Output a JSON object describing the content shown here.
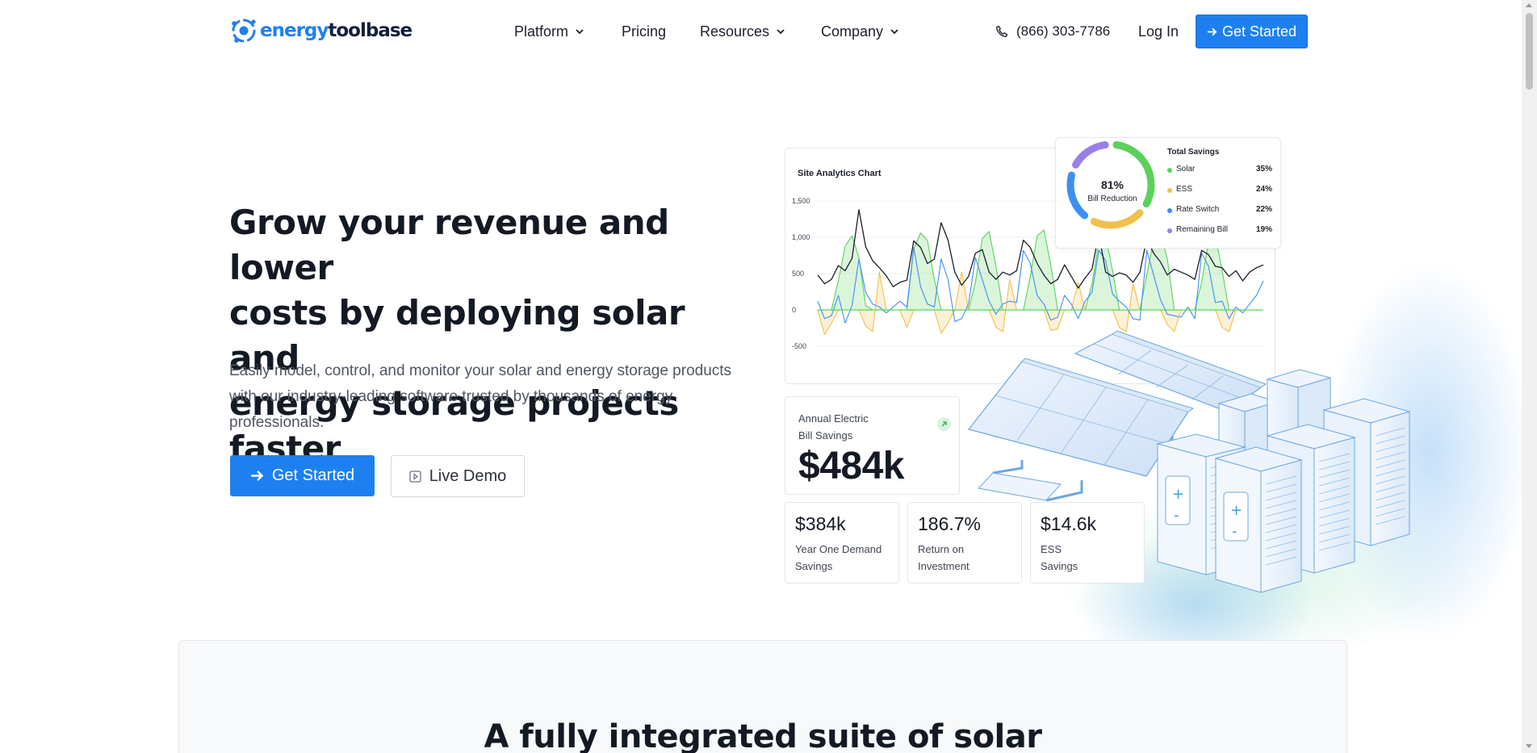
{
  "header": {
    "logo": {
      "part1": "energy",
      "part2": "toolbase"
    },
    "nav": [
      {
        "label": "Platform",
        "has_dropdown": true
      },
      {
        "label": "Pricing",
        "has_dropdown": false
      },
      {
        "label": "Resources",
        "has_dropdown": true
      },
      {
        "label": "Company",
        "has_dropdown": true
      }
    ],
    "phone": "(866) 303-7786",
    "login": "Log In",
    "cta": "Get Started"
  },
  "hero": {
    "title_lines": [
      "Grow your revenue and lower",
      "costs by deploying solar and",
      "energy storage projects faster"
    ],
    "subtitle_lines": [
      "Easily model, control, and monitor your solar and energy storage products",
      "with our industry-leading software trusted by thousands of energy",
      "professionals."
    ],
    "primary_button": "Get Started",
    "secondary_button": "Live Demo"
  },
  "colors": {
    "accent": "#1e80f0",
    "solar": "#5ad25a",
    "ess": "#f0c04a",
    "rate_switch": "#3c8ff0",
    "remaining_bill": "#9a7ee8",
    "load_line": "#1b1f2a"
  },
  "chart_data": {
    "type": "line",
    "title": "Site Analytics Chart",
    "ylim": [
      -500,
      1500
    ],
    "yticks": [
      "1,500",
      "1,000",
      "500",
      "0",
      "-500"
    ],
    "ytick_values": [
      1500,
      1000,
      500,
      0,
      -500
    ],
    "series": [
      {
        "color_key": "load_line",
        "values": [
          480,
          360,
          420,
          610,
          540,
          710,
          1380,
          870,
          680,
          580,
          470,
          320,
          380,
          410,
          950,
          860,
          640,
          700,
          1200,
          960,
          520,
          340,
          460,
          780,
          830,
          520,
          420,
          520,
          480,
          540,
          960,
          860,
          640,
          480,
          360,
          420,
          620,
          460,
          300,
          440,
          560,
          1050,
          520,
          460,
          510,
          480,
          380,
          520,
          980,
          780,
          660,
          480,
          560,
          520,
          480,
          420,
          820,
          760,
          600,
          580,
          460,
          540,
          400,
          520,
          580,
          620
        ]
      },
      {
        "color_key": "rate_switch",
        "values": [
          120,
          -120,
          -80,
          200,
          -180,
          60,
          700,
          240,
          80,
          40,
          -40,
          40,
          120,
          40,
          860,
          320,
          80,
          40,
          700,
          420,
          -160,
          -120,
          80,
          720,
          420,
          120,
          -60,
          80,
          120,
          100,
          820,
          640,
          200,
          80,
          -140,
          -100,
          200,
          80,
          -120,
          120,
          240,
          820,
          680,
          220,
          120,
          40,
          -120,
          -140,
          820,
          480,
          140,
          -60,
          -80,
          -100,
          40,
          -120,
          780,
          600,
          100,
          120,
          -120,
          40,
          -40,
          80,
          200,
          400
        ]
      },
      {
        "color_key": "solar",
        "values": [
          0,
          0,
          0,
          400,
          880,
          1020,
          720,
          60,
          0,
          0,
          0,
          0,
          0,
          0,
          840,
          1060,
          960,
          420,
          0,
          0,
          0,
          0,
          0,
          380,
          980,
          1080,
          600,
          0,
          0,
          0,
          0,
          460,
          1020,
          1100,
          620,
          0,
          0,
          0,
          0,
          0,
          360,
          940,
          1020,
          540,
          0,
          0,
          0,
          0,
          480,
          960,
          1060,
          700,
          0,
          0,
          0,
          0,
          380,
          940,
          1020,
          540,
          0,
          0,
          0,
          0,
          0,
          0
        ]
      },
      {
        "color_key": "ess",
        "values": [
          0,
          -340,
          -180,
          0,
          0,
          0,
          0,
          -220,
          -300,
          520,
          0,
          0,
          0,
          -240,
          0,
          0,
          0,
          0,
          -320,
          -180,
          0,
          520,
          0,
          0,
          0,
          0,
          -240,
          -300,
          420,
          0,
          0,
          0,
          0,
          0,
          -280,
          -260,
          0,
          0,
          380,
          0,
          0,
          0,
          0,
          0,
          -240,
          -300,
          360,
          0,
          0,
          0,
          0,
          -200,
          -300,
          0,
          0,
          0,
          0,
          0,
          0,
          -240,
          -300,
          0,
          0,
          0,
          0,
          0
        ]
      }
    ]
  },
  "donut": {
    "center_value": "81%",
    "center_label": "Bill Reduction",
    "legend_title": "Total Savings",
    "items": [
      {
        "name": "Solar",
        "pct": "35%",
        "value": 35,
        "color_key": "solar"
      },
      {
        "name": "ESS",
        "pct": "24%",
        "value": 24,
        "color_key": "ess"
      },
      {
        "name": "Rate Switch",
        "pct": "22%",
        "value": 22,
        "color_key": "rate_switch"
      },
      {
        "name": "Remaining Bill",
        "pct": "19%",
        "value": 19,
        "color_key": "remaining_bill"
      }
    ]
  },
  "stats": {
    "big": {
      "label_lines": [
        "Annual Electric",
        "Bill Savings"
      ],
      "value": "$484k"
    },
    "small": [
      {
        "value": "$384k",
        "label_lines": [
          "Year One Demand",
          "Savings"
        ]
      },
      {
        "value": "186.7%",
        "label_lines": [
          "Return on",
          "Investment"
        ]
      },
      {
        "value": "$14.6k",
        "label_lines": [
          "ESS",
          "Savings"
        ]
      }
    ]
  },
  "suite": {
    "title": "A fully integrated suite of solar"
  }
}
